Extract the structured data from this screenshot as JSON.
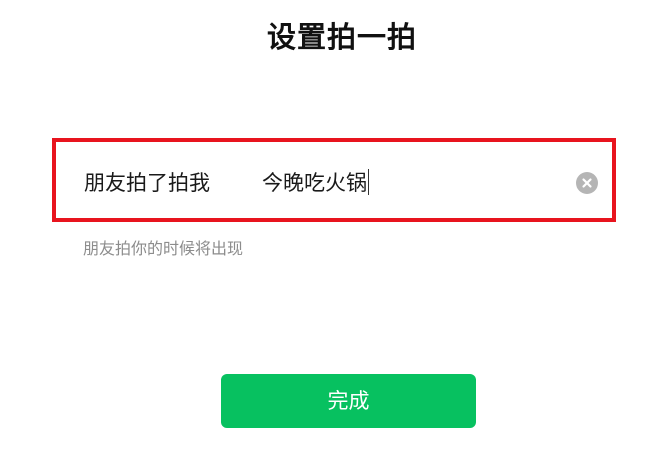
{
  "header": {
    "title": "设置拍一拍"
  },
  "pat_input": {
    "prefix": "朋友拍了拍我",
    "value": "今晚吃火锅",
    "hint": "朋友拍你的时候将出现"
  },
  "actions": {
    "done_label": "完成"
  },
  "colors": {
    "accent": "#07c160",
    "highlight_border": "#e8141e"
  },
  "icons": {
    "clear": "clear-circle-icon"
  }
}
